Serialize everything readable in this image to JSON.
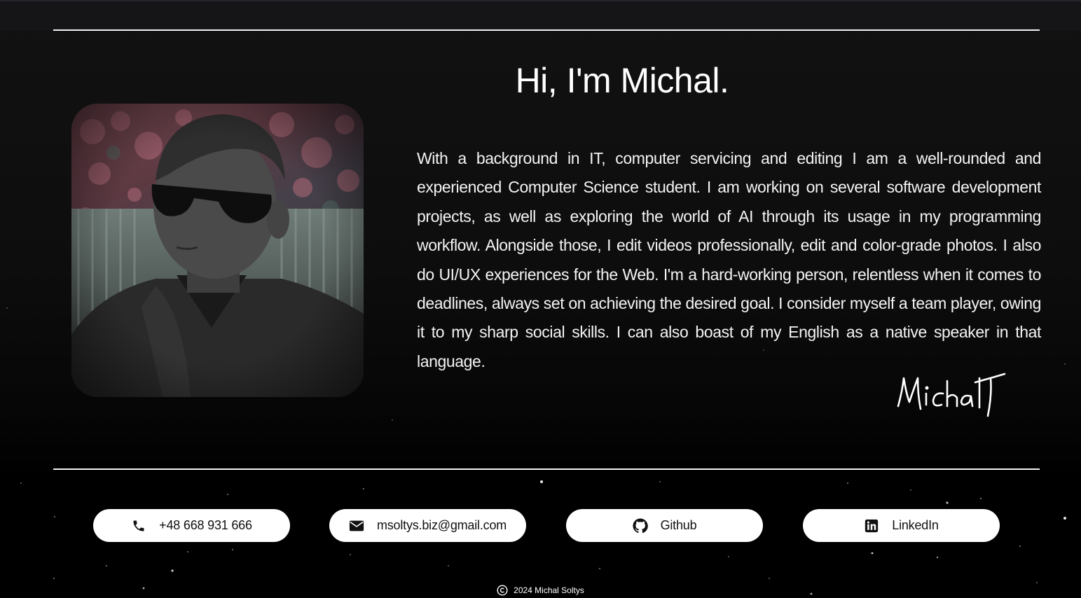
{
  "hero": {
    "title": "Hi, I'm Michal.",
    "bio": "With a background in IT, computer servicing and editing I am a well-rounded and experienced Computer Science student. I am working on several software development projects, as well as exploring the world of AI through its usage in my programming workflow. Alongside those, I edit videos professionally, edit and color-grade photos. I also do UI/UX experiences for the Web. I'm a hard-working person, relentless when it comes to deadlines, always set on achieving the desired goal. I consider myself a team player, owing it to my sharp social skills. I can also boast of my English as a native speaker in that language.",
    "signature": "Michal",
    "photo_icon": "portrait-photo"
  },
  "contacts": [
    {
      "icon": "phone-icon",
      "label": "+48 668 931 666"
    },
    {
      "icon": "envelope-icon",
      "label": "msoltys.biz@gmail.com"
    },
    {
      "icon": "github-icon",
      "label": "Github"
    },
    {
      "icon": "linkedin-icon",
      "label": "LinkedIn"
    }
  ],
  "footer": {
    "text": "2024 Michal Soltys",
    "icon": "copyright-icon"
  },
  "colors": {
    "background": "#000000",
    "text": "#ffffff",
    "button_bg": "#ffffff",
    "button_text": "#111111"
  }
}
